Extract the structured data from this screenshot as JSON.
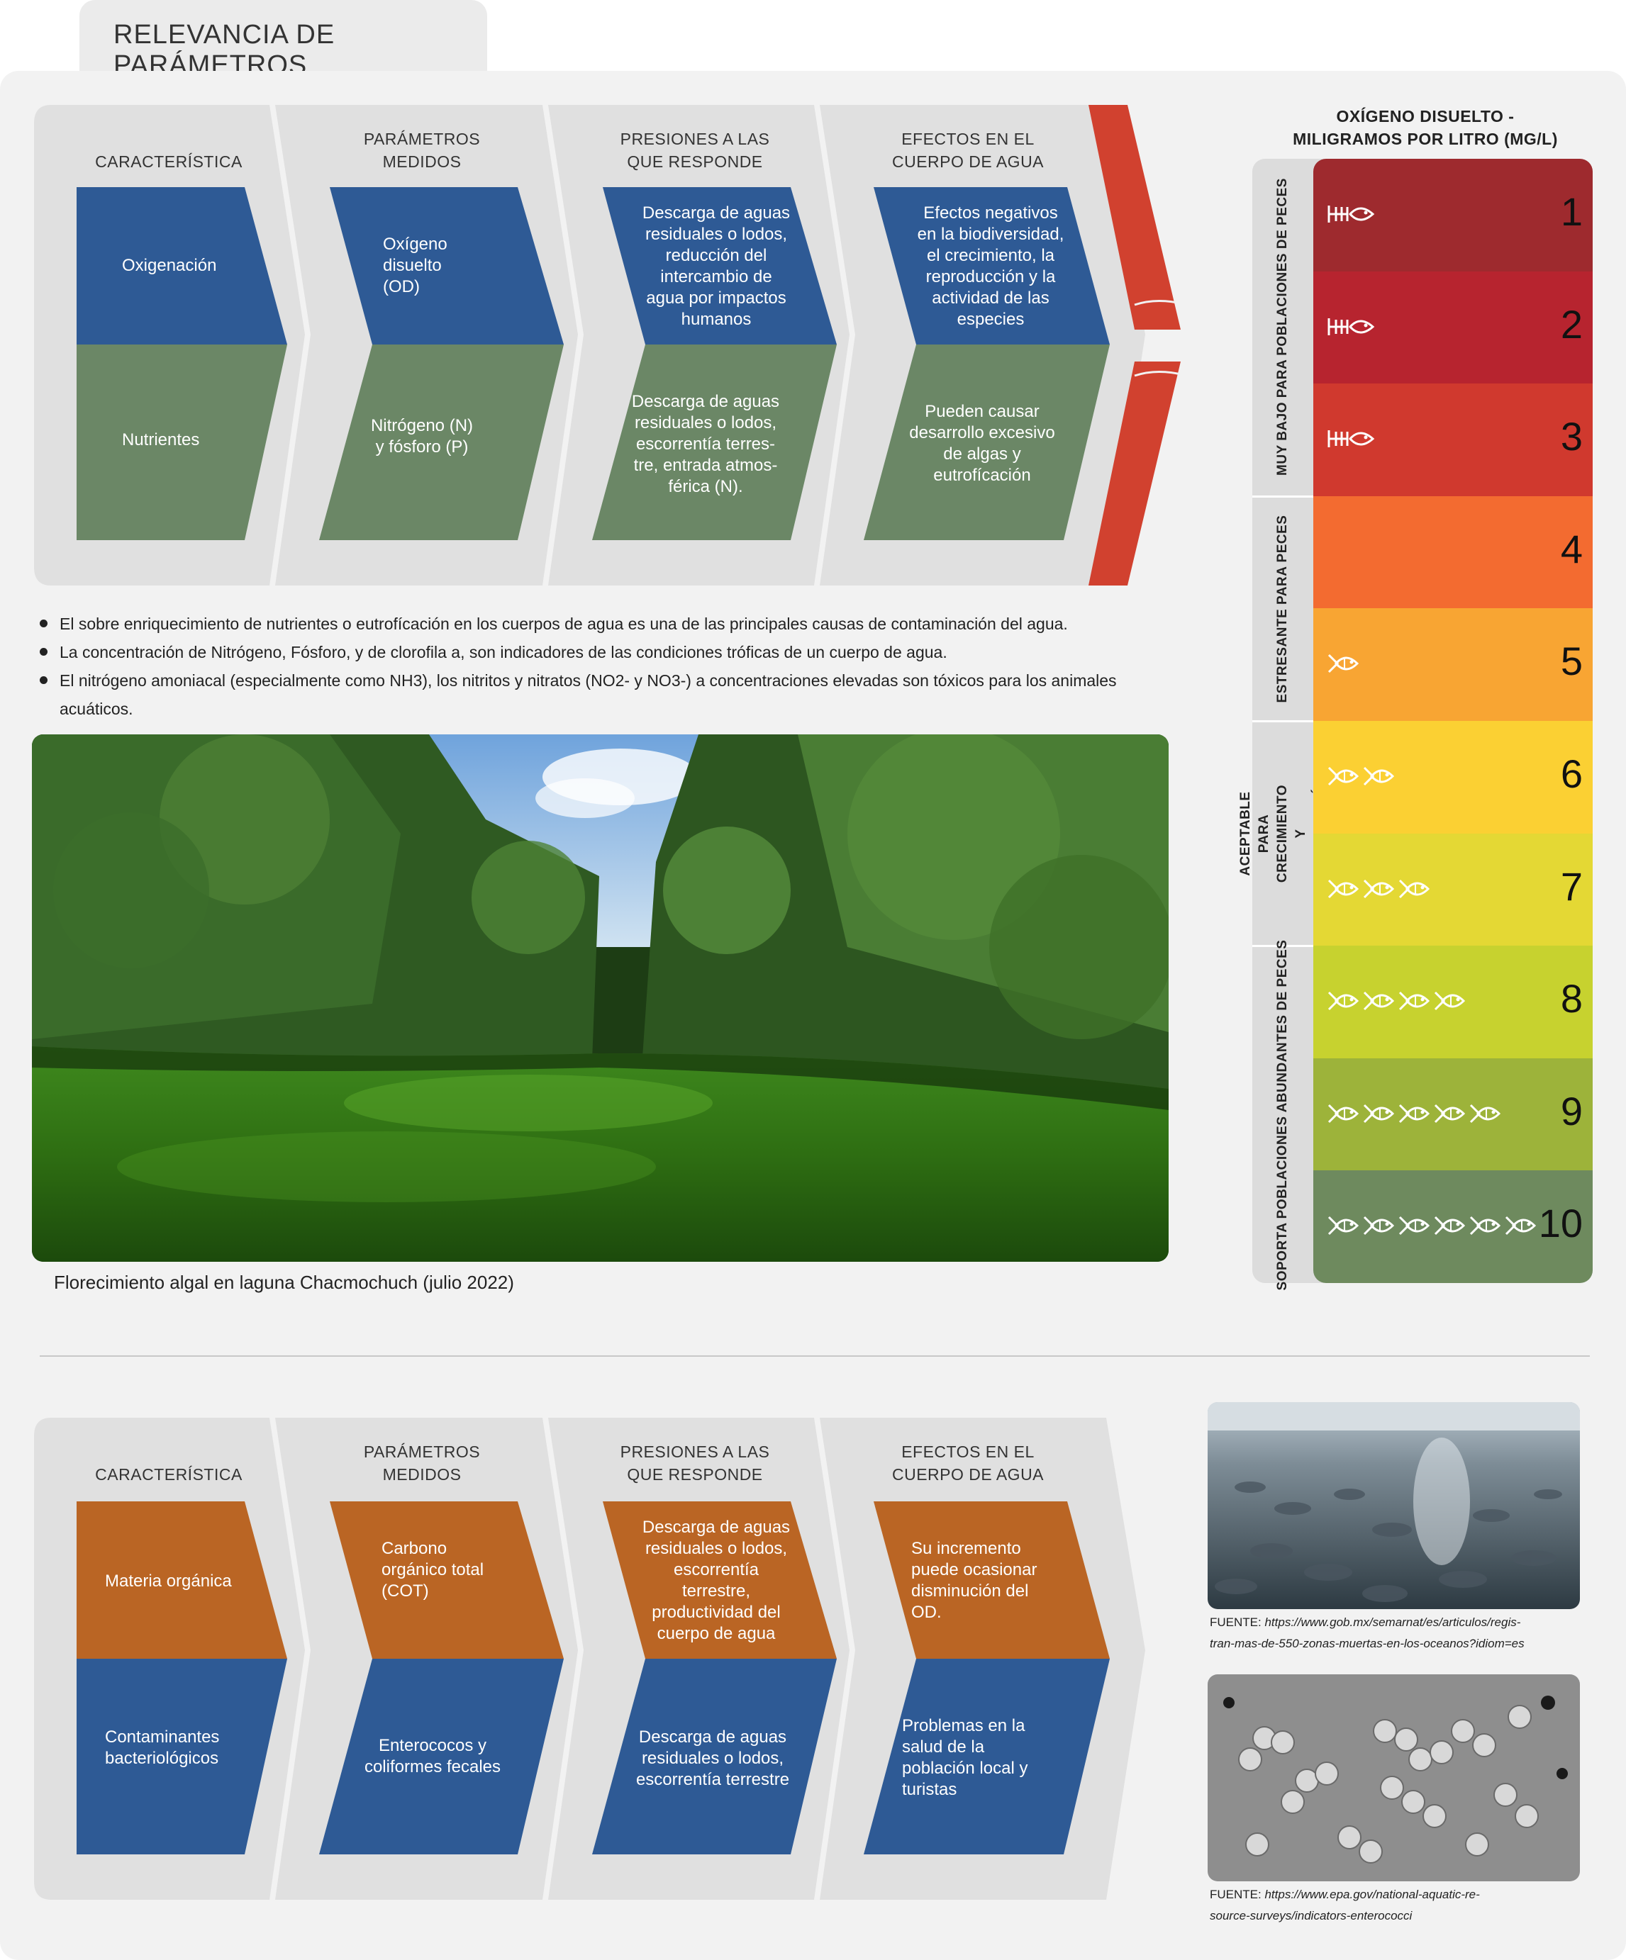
{
  "page": {
    "title": "RELEVANCIA DE PARÁMETROS"
  },
  "flow_top": {
    "headers": [
      "CARACTERÍSTICA",
      "PARÁMETROS\nMEDIDOS",
      "PRESIONES A LAS\nQUE RESPONDE",
      "EFECTOS EN EL\nCUERPO DE AGUA"
    ],
    "row1": [
      "Oxigenación",
      "Oxígeno\ndisuelto\n(OD)",
      "Descarga de aguas\nresiduales o lodos,\nreducción del\nintercambio de\nagua por impactos\nhumanos",
      "Efectos negativos\nen la biodiversidad,\nel crecimiento, la\nreproducción y la\nactividad de las\nespecies"
    ],
    "row2": [
      "Nutrientes",
      "Nitrógeno (N)\ny fósforo (P)",
      "Descarga de aguas\nresiduales o lodos,\nescorrentía terres-\ntre, entrada atmos-\nférica (N).",
      "Pueden causar\ndesarrollo excesivo\nde algas y\neutrofícación"
    ]
  },
  "bullets": [
    "El sobre enriquecimiento de nutrientes o eutrofícación en los cuerpos de agua es una de las principales causas de contaminación del agua.",
    "La concentración de Nitrógeno, Fósforo, y de clorofila a, son indicadores de las condiciones tróficas de un cuerpo de agua.",
    "El nitrógeno amoniacal (especialmente como NH3), los nitritos y nitratos (NO2- y NO3-) a concentraciones elevadas son tóxicos para los animales acuáticos."
  ],
  "photo_caption": "Florecimiento algal en laguna Chacmochuch (julio 2022)",
  "do_scale": {
    "title_line1": "OXÍGENO DISUELTO -",
    "title_line2": "MILIGRAMOS POR LITRO (MG/L)",
    "groups": [
      {
        "label": "MUY BAJO PARA POBLACIONES DE PECES"
      },
      {
        "label": "ESTRESANTE PARA PECES"
      },
      {
        "label": "ACEPTABLE PARA CRECIMIENTO\nY REPRODUCCIÓN"
      },
      {
        "label": "SOPORTA POBLACIONES ABUNDANTES DE PECES"
      }
    ],
    "levels": [
      {
        "value": "1",
        "color": "#9e2a2e",
        "fish": 1,
        "dead": true
      },
      {
        "value": "2",
        "color": "#b7242f",
        "fish": 1,
        "dead": true
      },
      {
        "value": "3",
        "color": "#d0392e",
        "fish": 1,
        "dead": true
      },
      {
        "value": "4",
        "color": "#f36b30",
        "fish": 0,
        "dead": false
      },
      {
        "value": "5",
        "color": "#f8a533",
        "fish": 1,
        "dead": false
      },
      {
        "value": "6",
        "color": "#fbd033",
        "fish": 2,
        "dead": false
      },
      {
        "value": "7",
        "color": "#e4d834",
        "fish": 3,
        "dead": false
      },
      {
        "value": "8",
        "color": "#c7d22f",
        "fish": 4,
        "dead": false
      },
      {
        "value": "9",
        "color": "#9db33a",
        "fish": 5,
        "dead": false
      },
      {
        "value": "10",
        "color": "#6e8a5e",
        "fish": 6,
        "dead": false
      }
    ]
  },
  "flow_bottom": {
    "headers": [
      "CARACTERÍSTICA",
      "PARÁMETROS\nMEDIDOS",
      "PRESIONES A LAS\nQUE RESPONDE",
      "EFECTOS EN EL\nCUERPO DE AGUA"
    ],
    "row1": [
      "Materia orgánica",
      "Carbono\norgánico total\n(COT)",
      "Descarga de aguas\nresiduales o lodos,\nescorrentía\nterrestre,\nproductividad del\ncuerpo de agua",
      "Su incremento\npuede ocasionar\ndisminución del\nOD."
    ],
    "row2": [
      "Contaminantes\nbacteriológicos",
      "Enterococos y\ncoliformes fecales",
      "Descarga de aguas\nresiduales o lodos,\nescorrentía terrestre",
      "Problemas en la\nsalud de la\npoblación local y\nturistas"
    ]
  },
  "sources": [
    {
      "label": "FUENTE:",
      "url": "https://www.gob.mx/semarnat/es/articulos/regis-\ntran-mas-de-550-zonas-muertas-en-los-oceanos?idiom=es"
    },
    {
      "label": "FUENTE:",
      "url": "https://www.epa.gov/national-aquatic-re-\nsource-surveys/indicators-enterococci"
    }
  ],
  "colors": {
    "blue": "#2e5a95",
    "green": "#6b8766",
    "orange": "#ba6524",
    "red_accent": "#d1412f",
    "chevron_bg": "#e0e0e0"
  }
}
